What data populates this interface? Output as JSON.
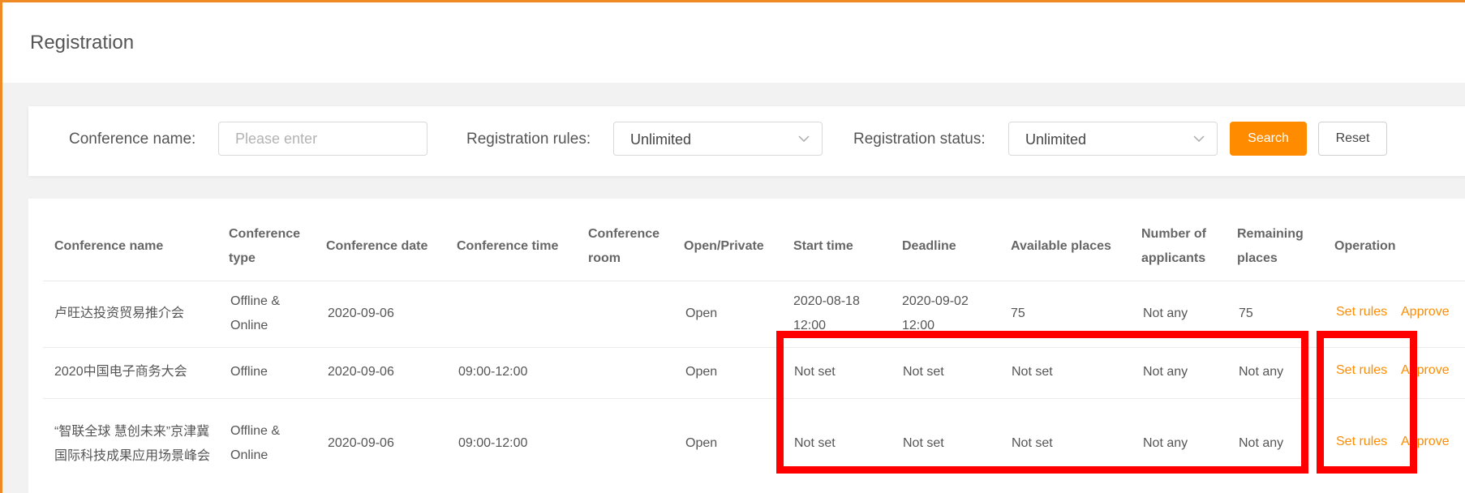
{
  "page": {
    "title": "Registration"
  },
  "filters": {
    "name_label": "Conference name:",
    "name_placeholder": "Please enter",
    "rules_label": "Registration rules:",
    "rules_value": "Unlimited",
    "status_label": "Registration status:",
    "status_value": "Unlimited",
    "search_label": "Search",
    "reset_label": "Reset"
  },
  "table": {
    "columns": [
      "Conference name",
      "Conference type",
      "Conference date",
      "Conference time",
      "Conference room",
      "Open/Private",
      "Start time",
      "Deadline",
      "Available places",
      "Number of applicants",
      "Remaining places",
      "Operation"
    ],
    "rows": [
      {
        "name": "卢旺达投资贸易推介会",
        "type": "Offline & Online",
        "date": "2020-09-06",
        "time": "",
        "room": "",
        "access": "Open",
        "start": "2020-08-18 12:00",
        "deadline": "2020-09-02 12:00",
        "available": "75",
        "applicants": "Not any",
        "remaining": "75",
        "op1": "Set rules",
        "op2": "Approve"
      },
      {
        "name": "2020中国电子商务大会",
        "type": "Offline",
        "date": "2020-09-06",
        "time": "09:00-12:00",
        "room": "",
        "access": "Open",
        "start": "Not set",
        "deadline": "Not set",
        "available": "Not set",
        "applicants": "Not any",
        "remaining": "Not any",
        "op1": "Set rules",
        "op2": "Approve"
      },
      {
        "name": "“智联全球 慧创未来”京津冀国际科技成果应用场景峰会",
        "type": "Offline & Online",
        "date": "2020-09-06",
        "time": "09:00-12:00",
        "room": "",
        "access": "Open",
        "start": "Not set",
        "deadline": "Not set",
        "available": "Not set",
        "applicants": "Not any",
        "remaining": "Not any",
        "op1": "Set rules",
        "op2": "Approve"
      }
    ]
  },
  "colors": {
    "accent": "#ff8c00",
    "frame": "#f08a24",
    "highlight": "#ff0000"
  },
  "icons": {
    "select_arrow": "chevron-down-icon"
  }
}
